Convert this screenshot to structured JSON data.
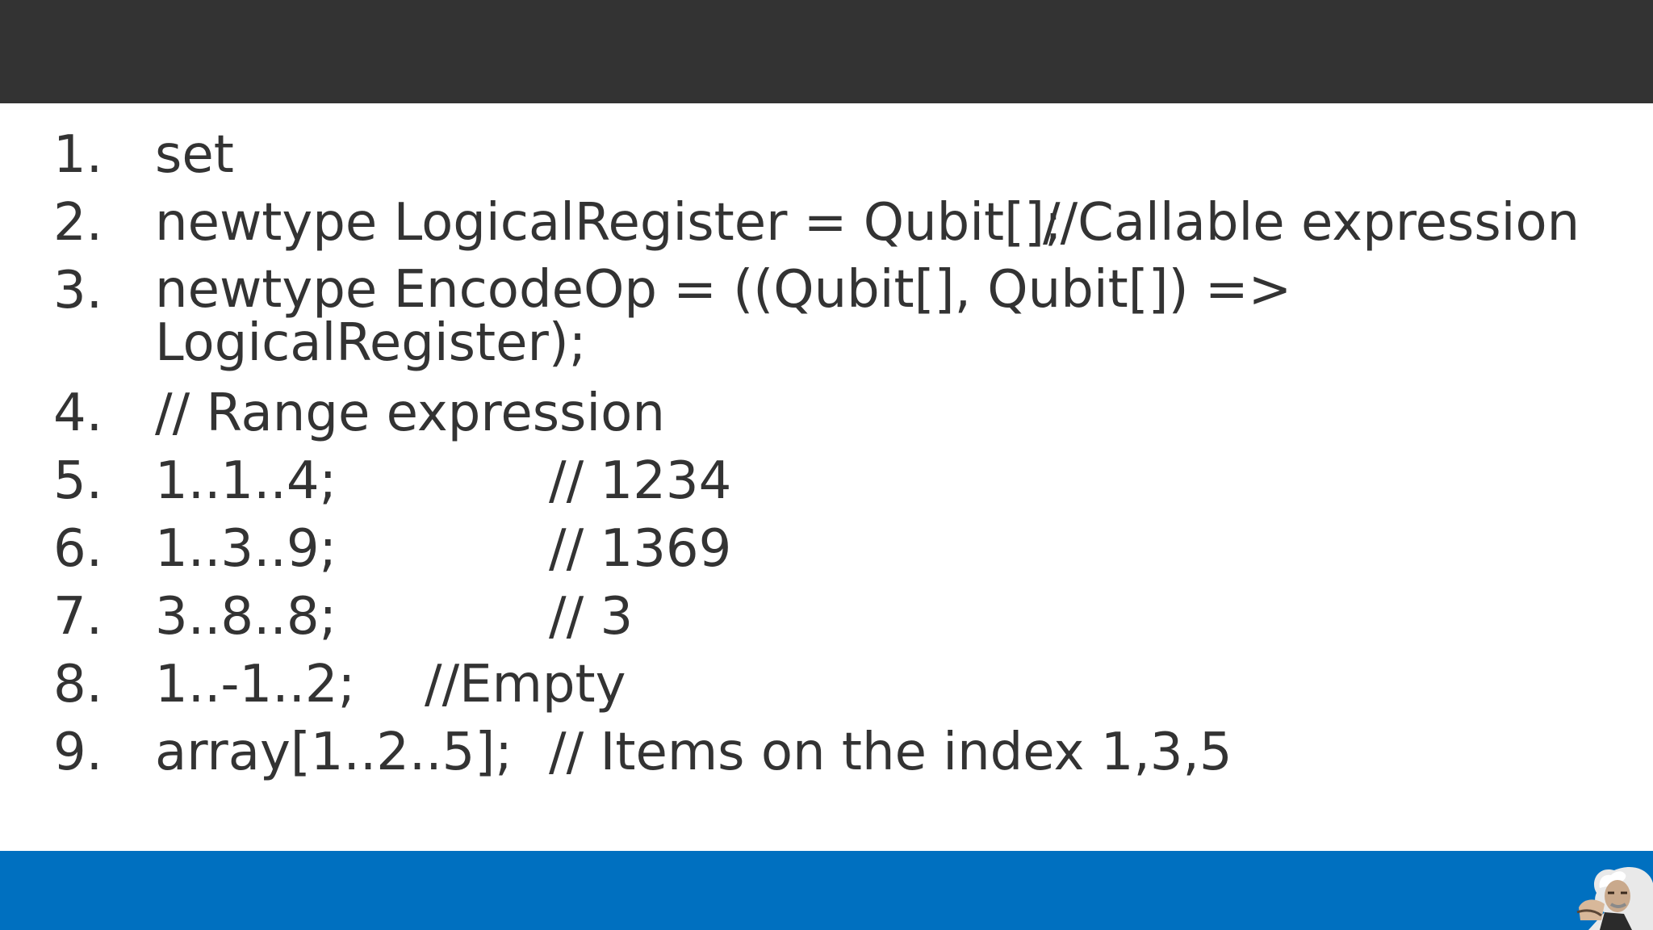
{
  "slide": {
    "colors": {
      "top_bar": "#333333",
      "bottom_bar": "#0070c0",
      "text": "#333333"
    },
    "items": [
      {
        "number": "1.",
        "code": "set",
        "comment": ""
      },
      {
        "number": "2.",
        "code": "newtype LogicalRegister = Qubit[];",
        "comment": "//Callable expression"
      },
      {
        "number": "3.",
        "code": "newtype EncodeOp = ((Qubit[], Qubit[]) => LogicalRegister);",
        "comment": ""
      },
      {
        "number": "4.",
        "code": "// Range expression",
        "comment": ""
      },
      {
        "number": "5.",
        "code": "1..1..4;",
        "comment": "// 1234"
      },
      {
        "number": "6.",
        "code": "1..3..9;",
        "comment": "// 1369"
      },
      {
        "number": "7.",
        "code": "3..8..8;",
        "comment": "// 3"
      },
      {
        "number": "8.",
        "code": "1..-1..2;",
        "comment": "//Empty"
      },
      {
        "number": "9.",
        "code": "array[1..2..5];",
        "comment": "// Items on the index 1,3,5"
      }
    ],
    "footer_image": "einstein-portrait"
  }
}
